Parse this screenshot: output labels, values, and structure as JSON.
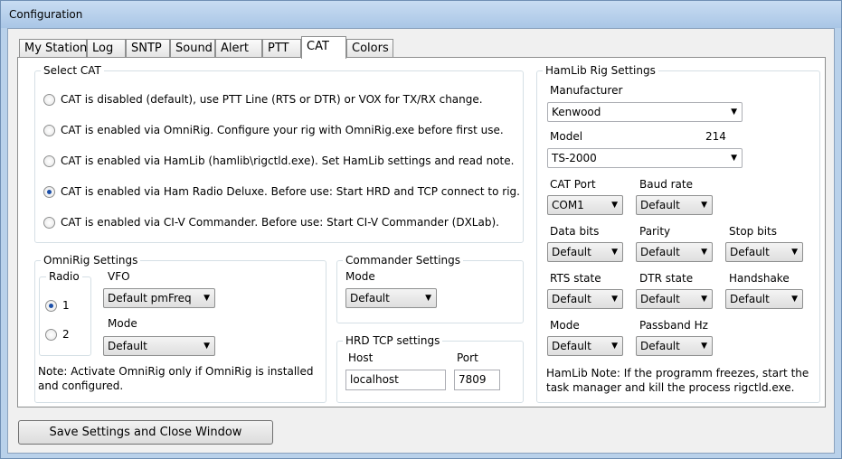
{
  "window": {
    "title": "Configuration"
  },
  "tabs": [
    "My Station",
    "Log",
    "SNTP",
    "Sound",
    "Alert",
    "PTT",
    "CAT",
    "Colors"
  ],
  "active_tab": "CAT",
  "select_cat": {
    "legend": "Select CAT",
    "options": [
      {
        "label": "CAT is disabled (default), use PTT Line (RTS or DTR) or VOX for TX/RX change.",
        "checked": false
      },
      {
        "label": "CAT is enabled via OmniRig. Configure your rig with OmniRig.exe before first use.",
        "checked": false
      },
      {
        "label": "CAT is enabled via HamLib (hamlib\\rigctld.exe). Set HamLib settings and read note.",
        "checked": false
      },
      {
        "label": "CAT is enabled via Ham Radio Deluxe. Before use: Start HRD and TCP connect to rig.",
        "checked": true
      },
      {
        "label": "CAT is enabled via CI-V Commander. Before use: Start CI-V Commander (DXLab).",
        "checked": false
      }
    ]
  },
  "omnirig": {
    "legend": "OmniRig Settings",
    "radio_legend": "Radio",
    "radio_options": [
      "1",
      "2"
    ],
    "vfo_label": "VFO",
    "vfo_value": "Default pmFreq",
    "mode_label": "Mode",
    "mode_value": "Default",
    "note": "Note: Activate OmniRig only if OmniRig is installed and configured."
  },
  "commander": {
    "legend": "Commander Settings",
    "mode_label": "Mode",
    "mode_value": "Default"
  },
  "hrd_tcp": {
    "legend": "HRD TCP settings",
    "host_label": "Host",
    "host_value": "localhost",
    "port_label": "Port",
    "port_value": "7809"
  },
  "hamlib": {
    "legend": "HamLib Rig Settings",
    "manufacturer_label": "Manufacturer",
    "manufacturer_value": "Kenwood",
    "model_label": "Model",
    "model_number": "214",
    "model_value": "TS-2000",
    "cat_port_label": "CAT Port",
    "cat_port_value": "COM1",
    "baud_rate_label": "Baud rate",
    "baud_rate_value": "Default",
    "data_bits_label": "Data bits",
    "data_bits_value": "Default",
    "parity_label": "Parity",
    "parity_value": "Default",
    "stop_bits_label": "Stop bits",
    "stop_bits_value": "Default",
    "rts_state_label": "RTS state",
    "rts_state_value": "Default",
    "dtr_state_label": "DTR state",
    "dtr_state_value": "Default",
    "handshake_label": "Handshake",
    "handshake_value": "Default",
    "mode_label": "Mode",
    "mode_value": "Default",
    "passband_label": "Passband Hz",
    "passband_value": "Default",
    "note": "HamLib Note: If the programm freezes, start the task manager and kill the process rigctld.exe."
  },
  "footer": {
    "save_button": "Save Settings and Close Window"
  },
  "icons": {
    "dropdown": "chevron-down-icon",
    "radio": "radio-button"
  }
}
